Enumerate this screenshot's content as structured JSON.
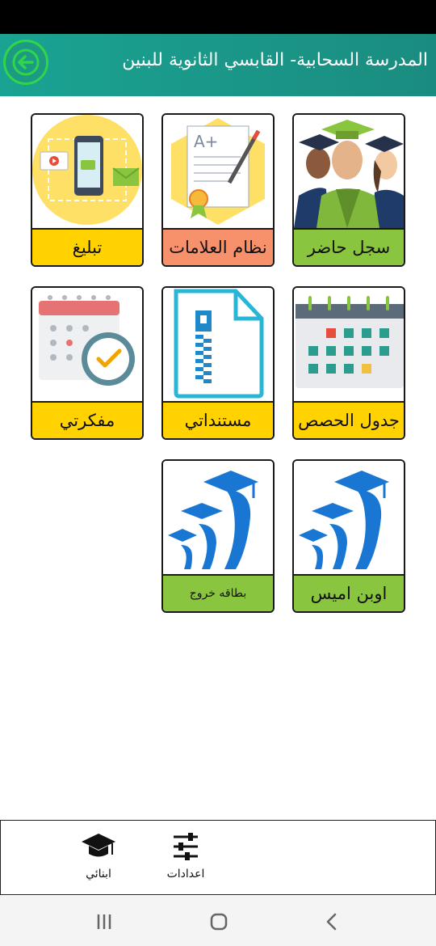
{
  "header": {
    "title": "المدرسة السحابية- القابسي الثانوية للبنين",
    "accent_color": "#1a9a88",
    "back_icon": "arrow-left-icon"
  },
  "tiles": [
    {
      "label": "سجل حاضر",
      "icon": "graduates-icon",
      "color": "#8ac53f"
    },
    {
      "label": "نظام العلامات",
      "icon": "grade-paper-icon",
      "color": "#f6916b"
    },
    {
      "label": "تبليغ",
      "icon": "phone-message-icon",
      "color": "#ffd200"
    },
    {
      "label": "جدول الحصص",
      "icon": "calendar-icon",
      "color": "#ffd200"
    },
    {
      "label": "مستنداتي",
      "icon": "zip-document-icon",
      "color": "#ffd200"
    },
    {
      "label": "مفكرتي",
      "icon": "calendar-clock-icon",
      "color": "#ffd200"
    },
    {
      "label": "اوبن اميس",
      "icon": "growth-caps-icon",
      "color": "#8ac53f"
    },
    {
      "label": "بطاقه خروج",
      "icon": "growth-caps-icon",
      "color": "#8ac53f"
    }
  ],
  "bottom_nav": {
    "children": {
      "label": "ابنائي",
      "icon": "graduation-cap-icon"
    },
    "settings": {
      "label": "اعدادات",
      "icon": "sliders-icon"
    }
  },
  "system_nav": {
    "recents_icon": "recents-icon",
    "home_icon": "home-icon",
    "back_icon": "chevron-left-icon"
  }
}
